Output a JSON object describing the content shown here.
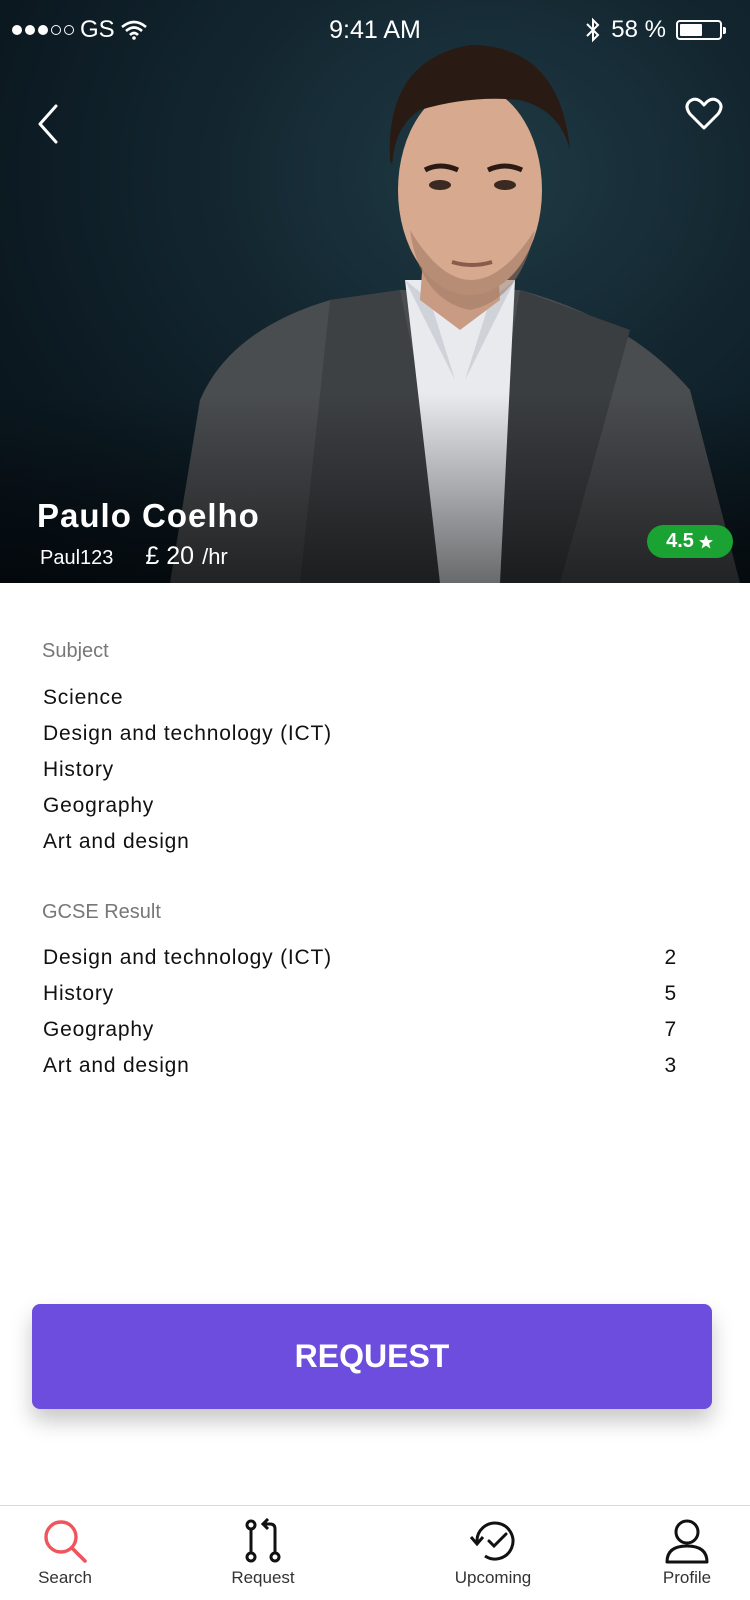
{
  "status_bar": {
    "carrier": "GS",
    "time": "9:41 AM",
    "battery_text": "58 %",
    "battery_level": 0.58
  },
  "tutor": {
    "name": "Paulo Coelho",
    "username": "Paul123",
    "price": "£ 20",
    "price_unit": "/hr",
    "rating": "4.5"
  },
  "subjects": {
    "label": "Subject",
    "items": [
      "Science",
      "Design and technology (ICT)",
      "History",
      "Geography",
      "Art and design"
    ]
  },
  "gcse": {
    "label": "GCSE Result",
    "rows": [
      {
        "subject": "Design and technology (ICT)",
        "grade": "2"
      },
      {
        "subject": "History",
        "grade": "5"
      },
      {
        "subject": "Geography",
        "grade": "7"
      },
      {
        "subject": "Art and design",
        "grade": "3"
      }
    ]
  },
  "request_button": "REQUEST",
  "tabs": [
    {
      "label": "Search",
      "icon": "search-icon",
      "active": true
    },
    {
      "label": "Request",
      "icon": "request-icon",
      "active": false
    },
    {
      "label": "Upcoming",
      "icon": "upcoming-icon",
      "active": false
    },
    {
      "label": "Profile",
      "icon": "profile-icon",
      "active": false
    }
  ],
  "colors": {
    "accent": "#6c4ddd",
    "rating_badge": "#1aa332",
    "active_tab": "#f0545c"
  }
}
